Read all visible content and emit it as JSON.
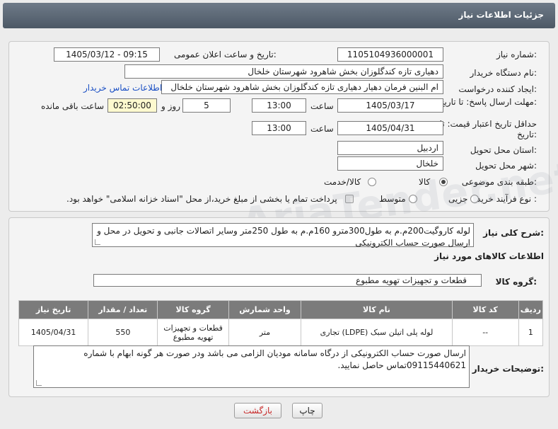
{
  "header": {
    "title": "جزئیات اطلاعات نیاز"
  },
  "form": {
    "need_number_label": "شماره نیاز:",
    "need_number": "1105104936000001",
    "announce_label": "تاریخ و ساعت اعلان عمومی:",
    "announce_value": "1405/03/12 - 09:15",
    "buyer_org_label": "نام دستگاه خریدار:",
    "buyer_org": "دهیاری تازه کندگلوزان بخش شاهرود شهرستان خلخال",
    "creator_label": "ایجاد کننده درخواست:",
    "creator": "ام البنین فرمان دهیار دهیاری تازه کندگلوزان بخش شاهرود شهرستان خلخال",
    "contact_link": "اطلاعات تماس خریدار",
    "deadline_label": "مهلت ارسال پاسخ: تا تاریخ:",
    "deadline_date": "1405/03/17",
    "time_label": "ساعت",
    "deadline_time": "13:00",
    "days_value": "5",
    "days_label": "روز و",
    "remaining_time": "02:50:00",
    "remaining_label": "ساعت باقی مانده",
    "validity_label": "حداقل تاریخ اعتبار قیمت: تا تاریخ:",
    "validity_date": "1405/04/31",
    "validity_time": "13:00",
    "province_label": "استان محل تحویل:",
    "province": "اردبیل",
    "city_label": "شهر محل تحویل:",
    "city": "خلخال",
    "category_label": "طبقه بندی موضوعی:",
    "category_options": [
      "کالا",
      "کالا/خدمت"
    ],
    "process_label": "نوع فرآیند خرید :",
    "process_options": [
      "جزیی",
      "متوسط"
    ],
    "payment_note": "پرداخت تمام یا بخشی از مبلغ خرید،از محل \"اسناد خزانه اسلامی\" خواهد بود."
  },
  "summary": {
    "label": "شرح کلی نیاز:",
    "text": "لوله کاروگیت200م.م به طول300مترو 160م.م به طول 250متر وسایر اتصالات جانبی و تحویل در محل و ارسال صورت حساب الکترونیکی"
  },
  "goods": {
    "section_title": "اطلاعات کالاهای مورد نیاز",
    "group_label": "گروه کالا:",
    "group_value": "قطعات و تجهیزات تهویه مطبوع",
    "columns": [
      "ردیف",
      "کد کالا",
      "نام کالا",
      "واحد شمارش",
      "گروه کالا",
      "تعداد / مقدار",
      "تاریخ نیاز"
    ],
    "rows": [
      {
        "row": "1",
        "code": "--",
        "name": "لوله پلی اتیلن سبک (LDPE) تجاری",
        "unit": "متر",
        "group": "قطعات و تجهیزات تهویه مطبوع",
        "qty": "550",
        "date": "1405/04/31"
      }
    ]
  },
  "buyer_notes": {
    "label": "توضیحات خریدار:",
    "text": "ارسال صورت حساب الکترونیکی از درگاه سامانه مودیان الزامی می باشد ودر صورت هر گونه ابهام با شماره 09115440621تماس حاصل نمایید."
  },
  "buttons": {
    "print": "چاپ",
    "back": "بازگشت"
  },
  "watermark": "AriaTender.net"
}
